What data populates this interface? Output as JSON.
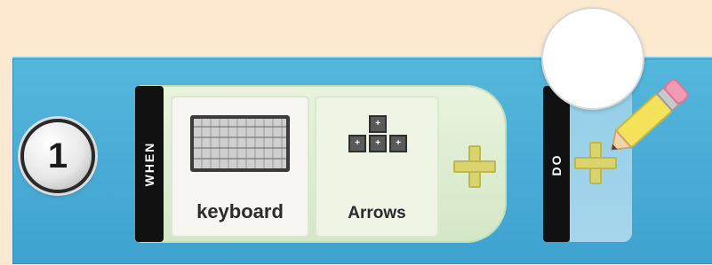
{
  "rule": {
    "number": "1",
    "when_label": "WHEN",
    "do_label": "DO"
  },
  "sensors": [
    {
      "label": "keyboard",
      "icon": "keyboard-icon"
    },
    {
      "label": "Arrows",
      "icon": "arrow-keys-icon"
    }
  ],
  "arrow_keys": [
    "+",
    "+",
    "+",
    "+"
  ],
  "icons": {
    "add_when": "plus-icon",
    "add_do": "plus-icon",
    "edit": "pencil-icon"
  },
  "colors": {
    "background": "#fbe8cf",
    "rule_bar": "#4aaed8",
    "when_panel": "#dcebd0",
    "strip": "#111111",
    "plus": "#d9d46d"
  }
}
